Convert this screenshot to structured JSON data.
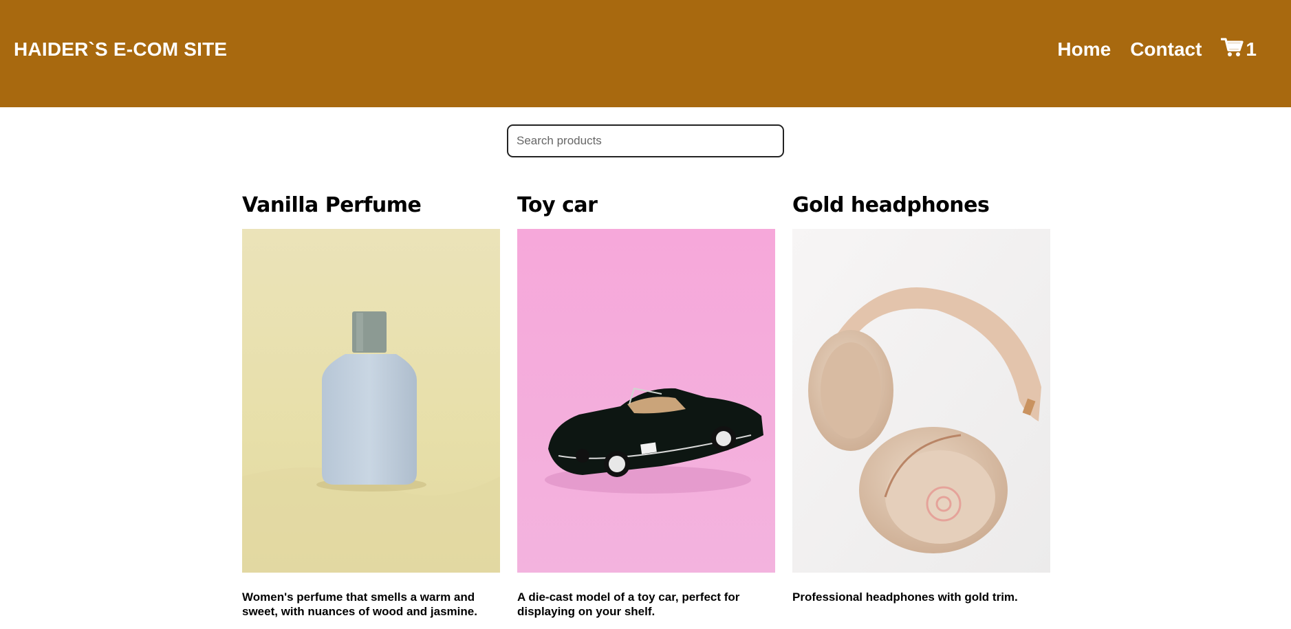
{
  "header": {
    "brand": "HAIDER`S E-COM SITE",
    "nav": [
      {
        "label": "Home"
      },
      {
        "label": "Contact"
      }
    ],
    "cart": {
      "icon": "cart-icon",
      "count": "1"
    }
  },
  "search": {
    "placeholder": "Search products",
    "value": ""
  },
  "products": [
    {
      "title": "Vanilla Perfume",
      "description": "Women's perfume that smells a warm and sweet, with nuances of wood and jasmine."
    },
    {
      "title": "Toy car",
      "description": "A die-cast model of a toy car, perfect for displaying on your shelf."
    },
    {
      "title": "Gold headphones",
      "description": "Professional headphones with gold trim."
    }
  ],
  "colors": {
    "header_bg": "#a8690f",
    "header_text": "#ffffff"
  }
}
